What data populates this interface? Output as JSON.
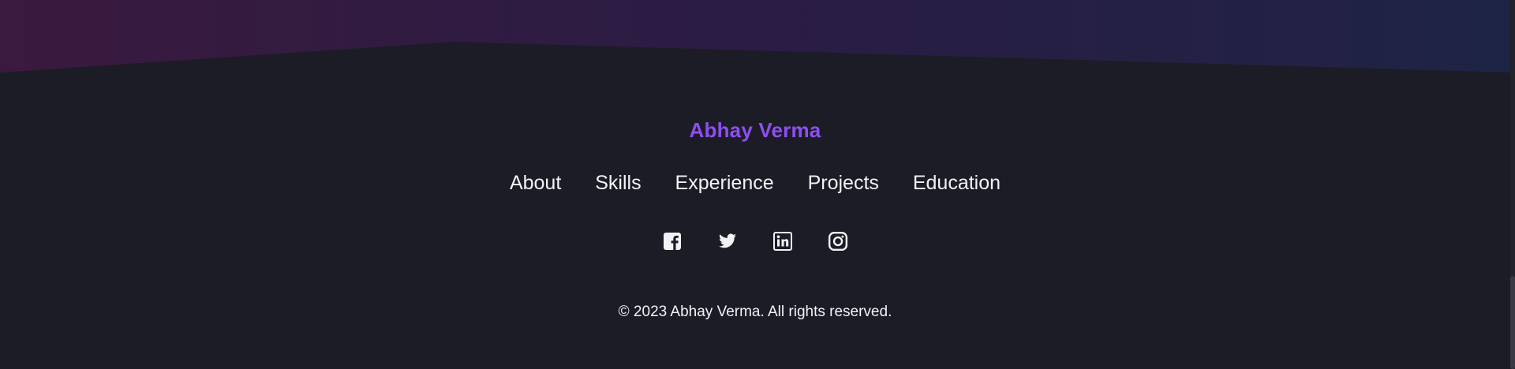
{
  "footer": {
    "brand": "Abhay Verma",
    "nav": [
      "About",
      "Skills",
      "Experience",
      "Projects",
      "Education"
    ],
    "socials": [
      "facebook-icon",
      "twitter-icon",
      "linkedin-icon",
      "instagram-icon"
    ],
    "copyright": "© 2023 Abhay Verma. All rights reserved."
  },
  "colors": {
    "background": "#1c1c26",
    "brand_accent": "#8e4ff0",
    "text": "#f2f2f6",
    "gradient_start": "#3a1a3e",
    "gradient_end": "#1e2240"
  }
}
